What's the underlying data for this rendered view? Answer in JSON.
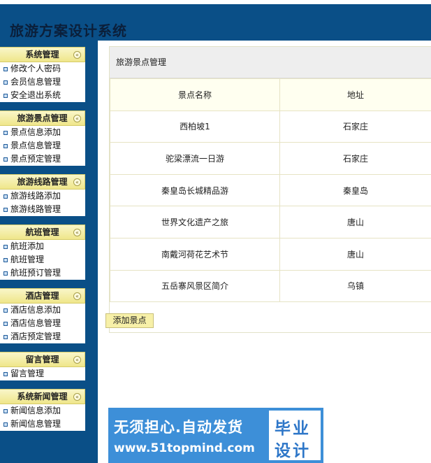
{
  "header": {
    "title": "旅游方案设计系统"
  },
  "sidebar": {
    "groups": [
      {
        "title": "系统管理",
        "items": [
          "修改个人密码",
          "会员信息管理",
          "安全退出系统"
        ]
      },
      {
        "title": "旅游景点管理",
        "items": [
          "景点信息添加",
          "景点信息管理",
          "景点预定管理"
        ]
      },
      {
        "title": "旅游线路管理",
        "items": [
          "旅游线路添加",
          "旅游线路管理"
        ]
      },
      {
        "title": "航班管理",
        "items": [
          "航班添加",
          "航班管理",
          "航班预订管理"
        ]
      },
      {
        "title": "酒店管理",
        "items": [
          "酒店信息添加",
          "酒店信息管理",
          "酒店预定管理"
        ]
      },
      {
        "title": "留言管理",
        "items": [
          "留言管理"
        ]
      },
      {
        "title": "系统新闻管理",
        "items": [
          "新闻信息添加",
          "新闻信息管理"
        ]
      }
    ]
  },
  "main": {
    "panel_title": "旅游景点管理",
    "columns": [
      "景点名称",
      "地址"
    ],
    "rows": [
      [
        "西柏坡1",
        "石家庄"
      ],
      [
        "驼梁漂流一日游",
        "石家庄"
      ],
      [
        "秦皇岛长城精品游",
        "秦皇岛"
      ],
      [
        "世界文化遗产之旅",
        "唐山"
      ],
      [
        "南戴河荷花艺术节",
        "唐山"
      ],
      [
        "五岳寨风景区简介",
        "乌镇"
      ]
    ],
    "add_button": "添加景点"
  },
  "watermark": {
    "line1": "无须担心.自动发货",
    "line2": "www.51topmind.com",
    "box_line1": "毕业",
    "box_line2": "设计"
  },
  "colors": {
    "header_bg": "#0a4f87",
    "menu_head": "#efe68a",
    "ad_blue": "#3d8fd8"
  }
}
